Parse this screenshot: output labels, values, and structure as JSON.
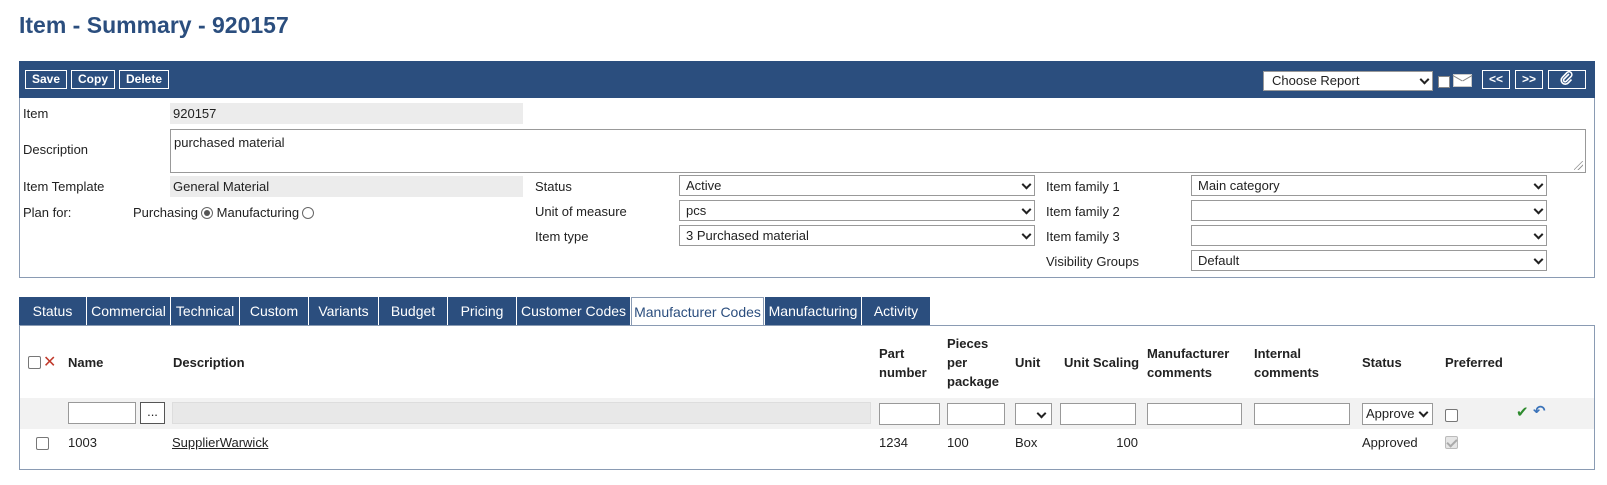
{
  "page": {
    "title": "Item - Summary - 920157"
  },
  "toolbar": {
    "save": "Save",
    "copy": "Copy",
    "delete": "Delete",
    "report": "Choose Report",
    "prev": "<<",
    "next": ">>",
    "attach_icon": "paperclip-icon",
    "mail_icon": "envelope-icon"
  },
  "form": {
    "item_label": "Item",
    "item_value": "920157",
    "description_label": "Description",
    "description_value": "purchased material",
    "template_label": "Item Template",
    "template_value": "General Material",
    "planfor_label": "Plan for:",
    "planfor_purchasing": "Purchasing",
    "planfor_manufacturing": "Manufacturing",
    "status_label": "Status",
    "status_value": "Active",
    "uom_label": "Unit of measure",
    "uom_value": "pcs",
    "itemtype_label": "Item type",
    "itemtype_value": "3 Purchased material",
    "family1_label": "Item family 1",
    "family1_value": "Main category",
    "family2_label": "Item family 2",
    "family2_value": "",
    "family3_label": "Item family 3",
    "family3_value": "",
    "visibility_label": "Visibility Groups",
    "visibility_value": "Default"
  },
  "tabs": [
    {
      "label": "Status"
    },
    {
      "label": "Commercial"
    },
    {
      "label": "Technical"
    },
    {
      "label": "Custom"
    },
    {
      "label": "Variants"
    },
    {
      "label": "Budget"
    },
    {
      "label": "Pricing"
    },
    {
      "label": "Customer Codes"
    },
    {
      "label": "Manufacturer Codes"
    },
    {
      "label": "Manufacturing"
    },
    {
      "label": "Activity"
    }
  ],
  "grid": {
    "headers": {
      "name": "Name",
      "description": "Description",
      "part_number": "Part number",
      "pieces": "Pieces per package",
      "unit": "Unit",
      "scaling": "Unit Scaling",
      "mfr_comments": "Manufacturer comments",
      "int_comments": "Internal comments",
      "status": "Status",
      "preferred": "Preferred"
    },
    "filter": {
      "lookup": "...",
      "status": "Approve"
    },
    "rows": [
      {
        "name": "1003",
        "description": "SupplierWarwick",
        "part_number": "1234",
        "pieces": "100",
        "unit": "Box",
        "scaling": "100",
        "status": "Approved"
      }
    ]
  }
}
